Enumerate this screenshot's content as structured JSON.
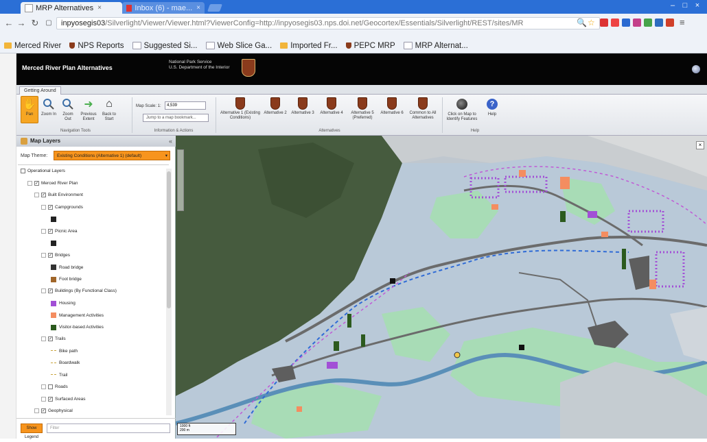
{
  "browser": {
    "tabs": [
      {
        "title": "MRP Alternatives",
        "close": "×"
      },
      {
        "title": "Inbox (6) - mae...",
        "close": "×"
      }
    ],
    "window_controls": [
      "–",
      "□",
      "×"
    ],
    "url_host": "inpyosegis03",
    "url_rest": "/Silverlight/Viewer/Viewer.html?ViewerConfig=http://inpyosegis03.nps.doi.net/Geocortex/Essentials/Silverlight/REST/sites/MR",
    "bookmarks": [
      {
        "label": "Merced River",
        "icon": "folder-icon",
        "color": "#f2b53a"
      },
      {
        "label": "NPS Reports",
        "icon": "nps-icon",
        "color": "#8a3b1c"
      },
      {
        "label": "Suggested Si...",
        "icon": "page-icon",
        "color": "#cfd8e6"
      },
      {
        "label": "Web Slice Ga...",
        "icon": "page-icon",
        "color": "#cfd8e6"
      },
      {
        "label": "Imported Fr...",
        "icon": "folder-icon",
        "color": "#f2b53a"
      },
      {
        "label": "PEPC MRP",
        "icon": "nps-icon",
        "color": "#8a3b1c"
      },
      {
        "label": "MRP Alternat...",
        "icon": "page-icon",
        "color": "#cfd8e6"
      }
    ]
  },
  "app": {
    "title": "Merced River Plan Alternatives",
    "org_line1": "National Park Service",
    "org_line2": "U.S. Department of the Interior"
  },
  "ribbon": {
    "tab": "Getting Around",
    "nav_buttons": [
      {
        "label": "Pan",
        "icon": "hand-icon"
      },
      {
        "label": "Zoom In",
        "icon": "zoom-in-icon"
      },
      {
        "label": "Zoom Out",
        "icon": "zoom-out-icon"
      },
      {
        "label": "Previous Extent",
        "icon": "back-arrow-icon"
      },
      {
        "label": "Back to Start",
        "icon": "home-icon"
      }
    ],
    "nav_group": "Navigation Tools",
    "scale_label": "Map Scale: 1:",
    "scale_value": "4,539",
    "bookmark_placeholder": "Jump to a map bookmark...",
    "info_group": "Information & Actions",
    "alternatives": [
      "Alternative 1 (Existing Conditions)",
      "Alternative 2",
      "Alternative 3",
      "Alternative 4",
      "Alternative 5 (Preferred)",
      "Alternative 6",
      "Common to All Alternatives"
    ],
    "alt_group": "Alternatives",
    "help_buttons": [
      {
        "label": "Click on Map to Identify Features",
        "icon": "identify-icon"
      },
      {
        "label": "Help",
        "icon": "help-icon"
      }
    ],
    "help_group": "Help"
  },
  "panel": {
    "title": "Map Layers",
    "theme_label": "Map Theme:",
    "theme_value": "Existing Conditions (Alternative 1) (default)",
    "tree": [
      {
        "label": "Operational Layers",
        "indent": 0,
        "check": false,
        "swatch": null
      },
      {
        "label": "Merced River Plan",
        "indent": 1,
        "check": true,
        "swatch": null
      },
      {
        "label": "Built Environment",
        "indent": 2,
        "check": true,
        "swatch": null
      },
      {
        "label": "Campgrounds",
        "indent": 3,
        "check": true,
        "swatch": null
      },
      {
        "label": "",
        "indent": 3,
        "check": null,
        "swatch": "#222222"
      },
      {
        "label": "Picnic Area",
        "indent": 3,
        "check": true,
        "swatch": null
      },
      {
        "label": "",
        "indent": 3,
        "check": null,
        "swatch": "#222222"
      },
      {
        "label": "Bridges",
        "indent": 3,
        "check": true,
        "swatch": null
      },
      {
        "label": "Road bridge",
        "indent": 3,
        "check": null,
        "swatch": "#333333"
      },
      {
        "label": "Foot bridge",
        "indent": 3,
        "check": null,
        "swatch": "#a0662a"
      },
      {
        "label": "Buildings (By Functional Class)",
        "indent": 3,
        "check": true,
        "swatch": null
      },
      {
        "label": "Housing",
        "indent": 3,
        "check": null,
        "swatch": "#a24fd6"
      },
      {
        "label": "Management Activities",
        "indent": 3,
        "check": null,
        "swatch": "#f48d60"
      },
      {
        "label": "Visitor-based Activities",
        "indent": 3,
        "check": null,
        "swatch": "#2c5a1e"
      },
      {
        "label": "Trails",
        "indent": 3,
        "check": true,
        "swatch": null
      },
      {
        "label": "Bike path",
        "indent": 3,
        "check": null,
        "swatch": "line"
      },
      {
        "label": "Boardwalk",
        "indent": 3,
        "check": null,
        "swatch": "line"
      },
      {
        "label": "Trail",
        "indent": 3,
        "check": null,
        "swatch": "line"
      },
      {
        "label": "Roads",
        "indent": 3,
        "check": false,
        "swatch": null
      },
      {
        "label": "Surfaced Areas",
        "indent": 3,
        "check": true,
        "swatch": null
      },
      {
        "label": "Geophysical",
        "indent": 2,
        "check": true,
        "swatch": null
      }
    ],
    "show_legend": "Show Legend",
    "filter_placeholder": "Filter"
  },
  "map": {
    "scale_text_1": "1000 ft",
    "scale_text_2": "200 m",
    "colors": {
      "forest": "#445a3c",
      "meadow": "#a6dcb4",
      "valley": "#b7c8d8",
      "river": "#5a8fb8",
      "road": "#6b6b6b",
      "housing": "#a24fd6",
      "management": "#f48d60",
      "visitor": "#2c5a1e"
    }
  }
}
